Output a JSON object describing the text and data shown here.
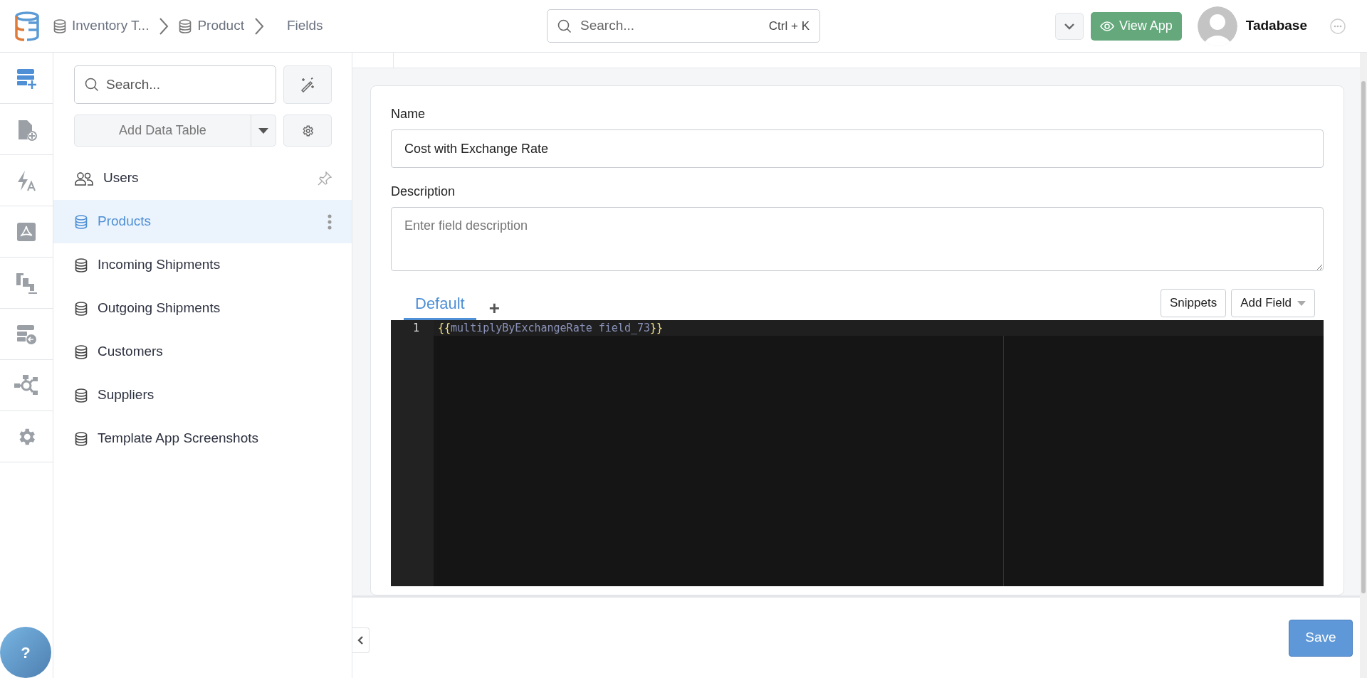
{
  "breadcrumb": [
    {
      "text": "Inventory T...",
      "icon": true
    },
    {
      "text": "Product",
      "icon": true
    },
    {
      "text": "Fields",
      "icon": false
    }
  ],
  "search": {
    "placeholder": "Search...",
    "shortcut": "Ctrl + K"
  },
  "view_app": "View App",
  "user": {
    "name": "Tadabase"
  },
  "rail": [
    {
      "kind": "tables",
      "selected": true
    },
    {
      "kind": "pages",
      "selected": false
    },
    {
      "kind": "automations",
      "selected": false
    },
    {
      "kind": "pdf",
      "selected": false
    },
    {
      "kind": "pipes",
      "selected": false
    },
    {
      "kind": "imports",
      "selected": false
    },
    {
      "kind": "integrations",
      "selected": false
    },
    {
      "kind": "settings",
      "selected": false
    }
  ],
  "sidebar": {
    "search_placeholder": "Search...",
    "add_button": "Add Data Table",
    "items": [
      {
        "kind": "users",
        "label": "Users",
        "selected": false
      },
      {
        "kind": "table",
        "label": "Products",
        "selected": true
      },
      {
        "kind": "table",
        "label": "Incoming Shipments",
        "selected": false
      },
      {
        "kind": "table",
        "label": "Outgoing Shipments",
        "selected": false
      },
      {
        "kind": "table",
        "label": "Customers",
        "selected": false
      },
      {
        "kind": "table",
        "label": "Suppliers",
        "selected": false
      },
      {
        "kind": "table",
        "label": "Template App Screenshots",
        "selected": false
      }
    ]
  },
  "form": {
    "name_label": "Name",
    "name_value": "Cost with Exchange Rate",
    "description_label": "Description",
    "description_placeholder": "Enter field description"
  },
  "editor": {
    "tabs": [
      {
        "label": "Default",
        "selected": true
      }
    ],
    "add_tab": "+",
    "buttons": [
      "Snippets",
      "Add Field"
    ],
    "lines": [
      {
        "number": "1",
        "tokens": [
          {
            "kind": "bracket",
            "text": "{{"
          },
          {
            "kind": "expr",
            "text": "multiplyByExchangeRate field_73"
          },
          {
            "kind": "bracket",
            "text": "}}"
          }
        ]
      }
    ]
  },
  "save_button": "Save",
  "help_button": "?"
}
